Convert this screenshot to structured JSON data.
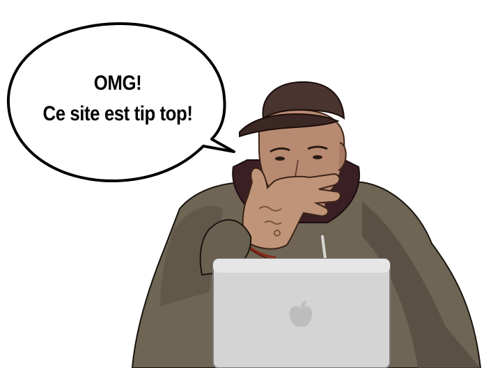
{
  "bubble": {
    "line1": "OMG!",
    "line2": "Ce site est tip top!"
  },
  "colors": {
    "background": "#ffffff",
    "bubble_fill": "#ffffff",
    "bubble_stroke": "#000000",
    "jacket": "#6f6554",
    "cap": "#4a3430",
    "skin": "#b98a72",
    "laptop": "#d4d4d4",
    "hoodie": "#3a1f24"
  },
  "icons": {
    "laptop_logo": "apple-logo-icon"
  }
}
